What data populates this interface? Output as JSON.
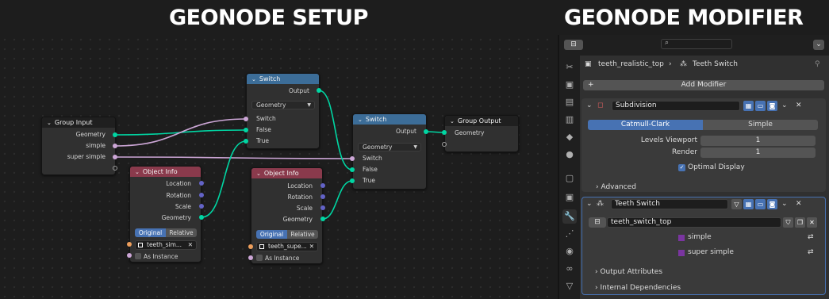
{
  "headings": {
    "setup": "GEONODE SETUP",
    "modifier": "GEONODE MODIFIER"
  },
  "colors": {
    "geometry_wire": "#00d6a3",
    "boolean_wire": "#cca6d6",
    "switch_header": "#3c6d98",
    "object_info_header": "#8a3a4c",
    "accent_blue": "#4772b3"
  },
  "nodes": {
    "group_input": {
      "title": "Group Input",
      "outputs": [
        "Geometry",
        "simple",
        "super simple"
      ]
    },
    "switch_a": {
      "title": "Switch",
      "output": "Output",
      "type": "Geometry",
      "inputs": [
        "Switch",
        "False",
        "True"
      ]
    },
    "switch_b": {
      "title": "Switch",
      "output": "Output",
      "type": "Geometry",
      "inputs": [
        "Switch",
        "False",
        "True"
      ]
    },
    "group_output": {
      "title": "Group Output",
      "inputs": [
        "Geometry"
      ]
    },
    "object_info_a": {
      "title": "Object Info",
      "outputs": [
        "Location",
        "Rotation",
        "Scale",
        "Geometry"
      ],
      "mode_original": "Original",
      "mode_relative": "Relative",
      "object": "teeth_sim...",
      "as_instance": "As Instance"
    },
    "object_info_b": {
      "title": "Object Info",
      "outputs": [
        "Location",
        "Rotation",
        "Scale",
        "Geometry"
      ],
      "mode_original": "Original",
      "mode_relative": "Relative",
      "object": "teeth_supe...",
      "as_instance": "As Instance"
    }
  },
  "properties": {
    "search_icon": "search-icon",
    "breadcrumb": {
      "object": "teeth_realistic_top",
      "modifier": "Teeth Switch"
    },
    "add_modifier": "Add Modifier",
    "subdivision": {
      "name": "Subdivision",
      "type_catmull": "Catmull-Clark",
      "type_simple": "Simple",
      "levels_viewport_label": "Levels Viewport",
      "levels_viewport_value": "1",
      "render_label": "Render",
      "render_value": "1",
      "optimal_display": "Optimal Display",
      "advanced": "Advanced"
    },
    "geonodes": {
      "name": "Teeth Switch",
      "node_group": "teeth_switch_top",
      "inputs": [
        "simple",
        "super simple"
      ],
      "output_attributes": "Output Attributes",
      "internal_dependencies": "Internal Dependencies"
    }
  }
}
